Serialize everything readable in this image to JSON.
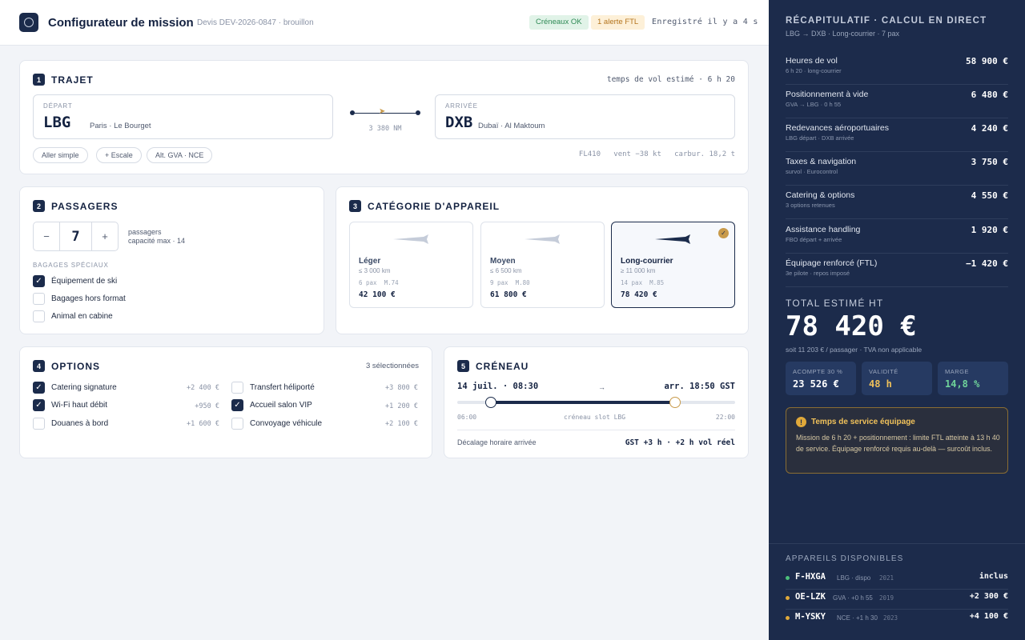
{
  "header": {
    "title": "Configurateur de mission",
    "quote_ref": "Devis DEV-2026-0847 · brouillon",
    "badge_ok": "Créneaux OK",
    "badge_warn": "1 alerte FTL",
    "saved": "Enregistré il y a 4 s"
  },
  "trajet": {
    "num": "1",
    "title": "TRAJET",
    "flight_time": "temps de vol estimé · 6 h 20",
    "departure": {
      "label": "DÉPART",
      "code": "LBG",
      "city": "Paris · Le Bourget"
    },
    "arrival": {
      "label": "ARRIVÉE",
      "code": "DXB",
      "city": "Dubaï · Al Maktoum"
    },
    "distance": "3 380 NM",
    "chips": [
      "Aller simple",
      "+ Escale",
      "Alt. GVA · NCE"
    ],
    "flight_meta": "FL410   vent −38 kt   carbur. 18,2 t"
  },
  "passagers": {
    "num": "2",
    "title": "PASSAGERS",
    "count": "7",
    "minus": "−",
    "plus": "+",
    "note_line1": "passagers",
    "note_line2": "capacité max · 14",
    "bagages_label": "BAGAGES SPÉCIAUX",
    "bagages": [
      {
        "label": "Équipement de ski",
        "checked": true
      },
      {
        "label": "Bagages hors format",
        "checked": false
      },
      {
        "label": "Animal en cabine",
        "checked": false
      }
    ]
  },
  "categorie": {
    "num": "3",
    "title": "CATÉGORIE D'APPAREIL",
    "cards": [
      {
        "name": "Léger",
        "range": "≤ 3 000 km",
        "spec": "6 pax  M.74",
        "price": "42 100 €",
        "selected": false
      },
      {
        "name": "Moyen",
        "range": "≤ 6 500 km",
        "spec": "9 pax  M.80",
        "price": "61 800 €",
        "selected": false
      },
      {
        "name": "Long-courrier",
        "range": "≥ 11 000 km",
        "spec": "14 pax  M.85",
        "price": "78 420 €",
        "selected": true
      }
    ]
  },
  "options": {
    "num": "4",
    "title": "OPTIONS",
    "selected_count": "3 sélectionnées",
    "items": [
      {
        "label": "Catering signature",
        "price": "+2 400 €",
        "checked": true
      },
      {
        "label": "Wi-Fi haut débit",
        "price": "+950 €",
        "checked": true
      },
      {
        "label": "Douanes à bord",
        "price": "+1 600 €",
        "checked": false
      },
      {
        "label": "Transfert héliporté",
        "price": "+3 800 €",
        "checked": false
      },
      {
        "label": "Accueil salon VIP",
        "price": "+1 200 €",
        "checked": true
      },
      {
        "label": "Convoyage véhicule",
        "price": "+2 100 €",
        "checked": false
      }
    ]
  },
  "creneau": {
    "num": "5",
    "title": "CRÉNEAU",
    "departure": "14 juil. · 08:30",
    "arrow": "→",
    "arrival": "arr. 18:50 GST",
    "scale_start": "06:00",
    "scale_mid": "créneau slot LBG",
    "scale_end": "22:00",
    "tz_label": "Décalage horaire arrivée",
    "tz_value": "GST +3 h · +2 h vol réel"
  },
  "recap": {
    "title": "RÉCAPITULATIF · CALCUL EN DIRECT",
    "subtitle": "LBG → DXB · Long-courrier · 7 pax",
    "lines": [
      {
        "label": "Heures de vol",
        "sub": "6 h 20 · long-courrier",
        "amount": "58 900 €"
      },
      {
        "label": "Positionnement à vide",
        "sub": "GVA → LBG · 0 h 55",
        "amount": "6 480 €"
      },
      {
        "label": "Redevances aéroportuaires",
        "sub": "LBG départ · DXB arrivée",
        "amount": "4 240 €"
      },
      {
        "label": "Taxes & navigation",
        "sub": "survol · Eurocontrol",
        "amount": "3 750 €"
      },
      {
        "label": "Catering & options",
        "sub": "3 options retenues",
        "amount": "4 550 €"
      },
      {
        "label": "Assistance handling",
        "sub": "FBO départ + arrivée",
        "amount": "1 920 €"
      },
      {
        "label": "Équipage renforcé (FTL)",
        "sub": "3e pilote · repos imposé",
        "amount": "−1 420 €"
      }
    ],
    "total_label": "TOTAL ESTIMÉ HT",
    "total_value": "78 420 €",
    "total_note": "soit 11 203 € / passager · TVA non applicable",
    "kpis": [
      {
        "label": "ACOMPTE 30 %",
        "value": "23 526 €",
        "color": "#ffffff"
      },
      {
        "label": "VALIDITÉ",
        "value": "48 h",
        "color": "#f0c15a"
      },
      {
        "label": "MARGE",
        "value": "14,8 %",
        "color": "#6fd39a"
      }
    ],
    "alert": {
      "icon": "!",
      "title": "Temps de service équipage",
      "text": "Mission de 6 h 20 + positionnement : limite FTL atteinte à 13 h 40 de service. Équipage renforcé requis au-delà — surcoût inclus."
    }
  },
  "fleet": {
    "title": "APPAREILS DISPONIBLES",
    "items": [
      {
        "reg": "F-HXGA",
        "info": "LBG · dispo",
        "year": "2021",
        "price": "inclus",
        "dot": "#4cc07a"
      },
      {
        "reg": "OE-LZK",
        "info": "GVA · +0 h 55",
        "year": "2019",
        "price": "+2 300 €",
        "dot": "#e0a93a"
      },
      {
        "reg": "M-YSKY",
        "info": "NCE · +1 h 30",
        "year": "2023",
        "price": "+4 100 €",
        "dot": "#e0a93a"
      }
    ]
  },
  "colors": {
    "navy": "#1b2b4b",
    "gold": "#c89a4a",
    "panel": "#1c2b4b"
  }
}
